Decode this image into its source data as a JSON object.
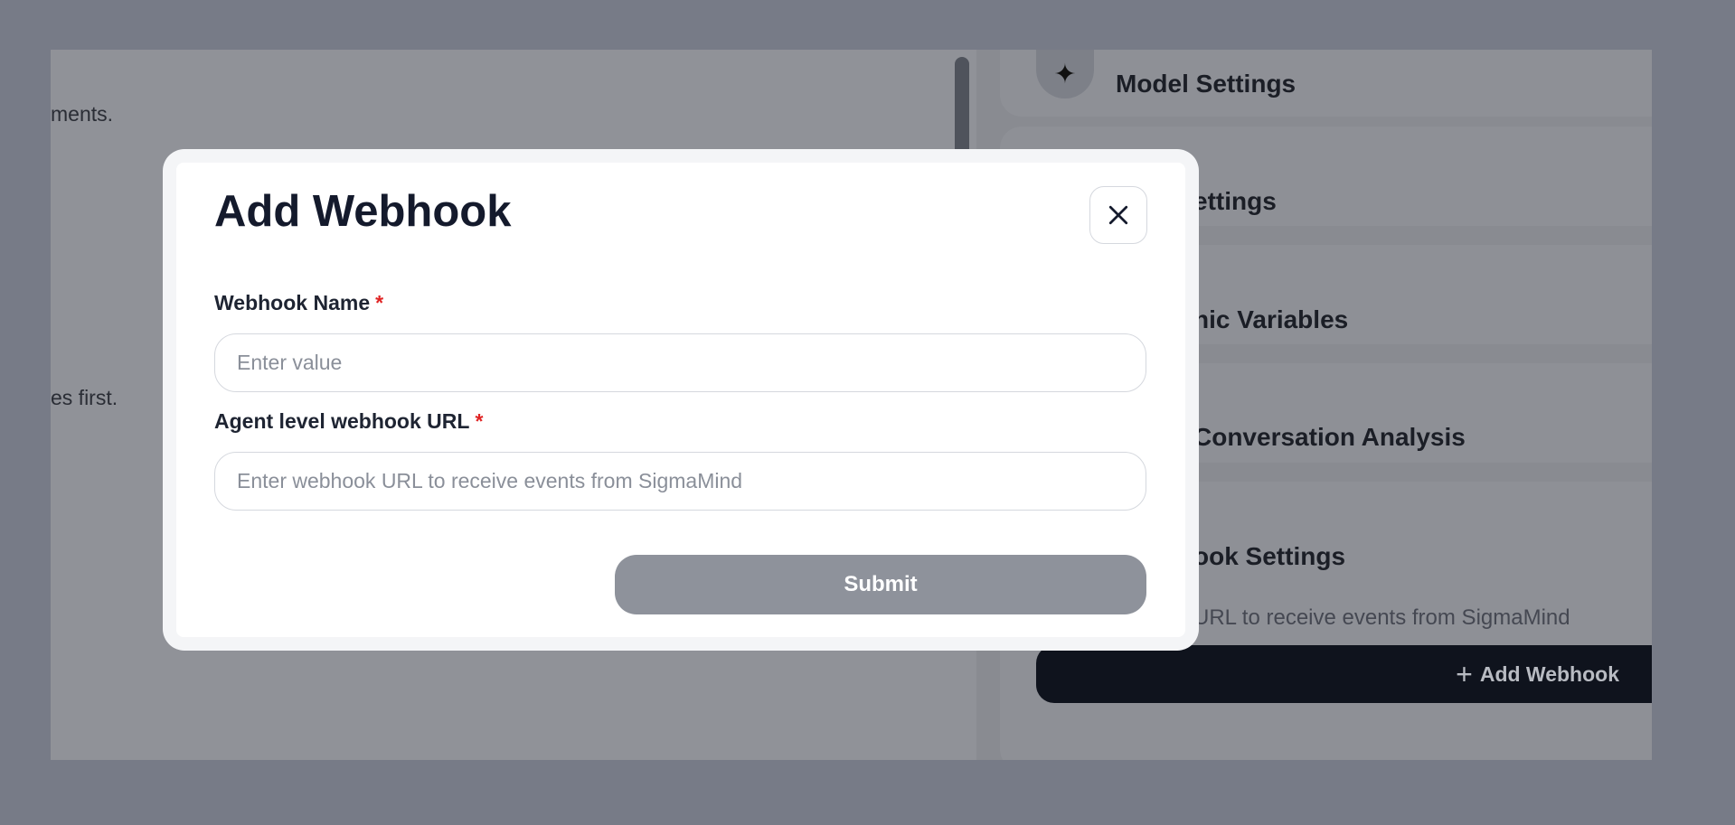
{
  "background": {
    "left_fragments": [
      "ments.",
      "es first."
    ],
    "right_sections": [
      {
        "title": "Model Settings",
        "icon": "puzzle-icon"
      },
      {
        "title": "ettings"
      },
      {
        "title": "nic Variables"
      },
      {
        "title": "Conversation Analysis"
      },
      {
        "title": "ook Settings"
      }
    ],
    "webhook_description": "URL to receive events from SigmaMind",
    "add_webhook_label": "Add Webhook"
  },
  "modal": {
    "title": "Add Webhook",
    "close_icon": "close-icon",
    "fields": [
      {
        "label": "Webhook Name",
        "required_mark": "*",
        "placeholder": "Enter value",
        "value": ""
      },
      {
        "label": "Agent level webhook URL",
        "required_mark": "*",
        "placeholder": "Enter webhook URL to receive events from SigmaMind",
        "value": ""
      }
    ],
    "submit_label": "Submit"
  },
  "colors": {
    "overlay": "#777b87",
    "primary_dark": "#0f131d",
    "required": "#e02424",
    "submit_disabled": "#8e929b"
  }
}
